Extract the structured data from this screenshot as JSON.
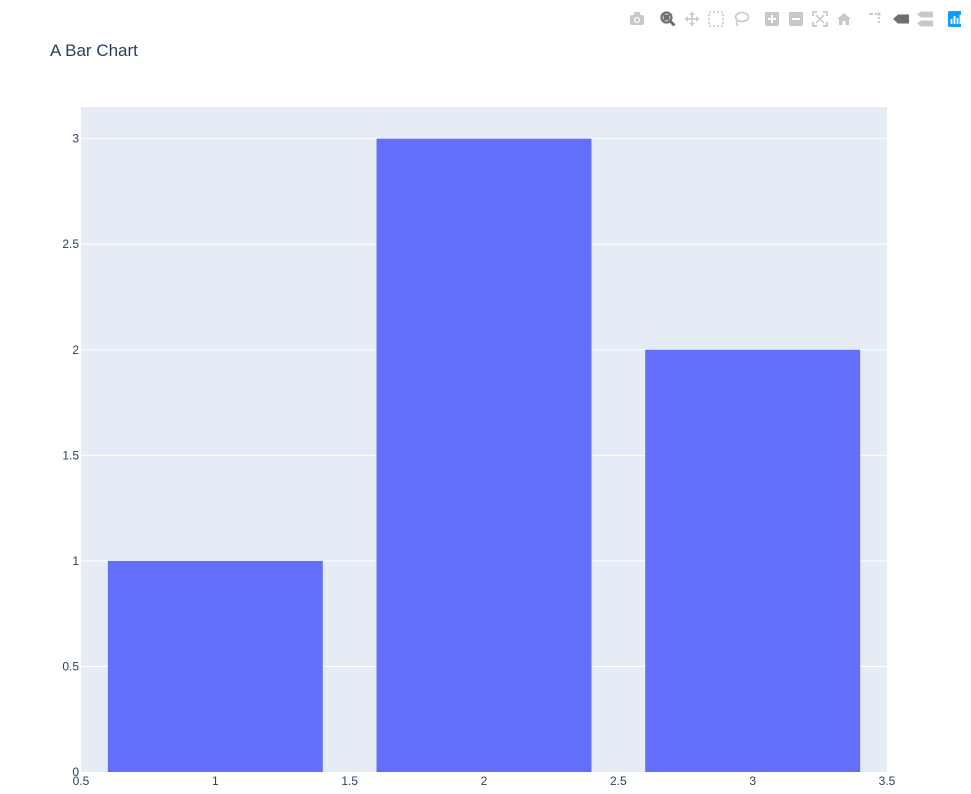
{
  "chart": {
    "title": "A Bar Chart"
  },
  "modebar": {
    "buttons": [
      {
        "name": "download-plot-icon",
        "active": false
      },
      {
        "name": "zoom-icon",
        "active": true
      },
      {
        "name": "pan-icon",
        "active": false
      },
      {
        "name": "box-select-icon",
        "active": false
      },
      {
        "name": "lasso-select-icon",
        "active": false
      },
      {
        "name": "zoom-in-icon",
        "active": false
      },
      {
        "name": "zoom-out-icon",
        "active": false
      },
      {
        "name": "autoscale-icon",
        "active": false
      },
      {
        "name": "reset-axes-icon",
        "active": false
      },
      {
        "name": "toggle-spike-lines-icon",
        "active": false
      },
      {
        "name": "hover-closest-icon",
        "active": true
      },
      {
        "name": "hover-compare-icon",
        "active": false
      },
      {
        "name": "plotly-logo-icon",
        "active": false
      }
    ]
  },
  "colors": {
    "bar": "#636efa",
    "plot_bg": "#e5ecf6",
    "grid": "#ffffff",
    "text": "#2a3f5f",
    "modebar_inactive": "#c8c8c8",
    "modebar_active": "#6e6e6e",
    "plotly_logo": "#119dff"
  },
  "chart_data": {
    "type": "bar",
    "title": "A Bar Chart",
    "x": [
      1,
      2,
      3
    ],
    "values": [
      1,
      3,
      2
    ],
    "xlabel": "",
    "ylabel": "",
    "xlim": [
      0.5,
      3.5
    ],
    "ylim": [
      0,
      3.15
    ],
    "xticks": [
      "0.5",
      "1",
      "1.5",
      "2",
      "2.5",
      "3",
      "3.5"
    ],
    "yticks": [
      "0",
      "0.5",
      "1",
      "1.5",
      "2",
      "2.5",
      "3"
    ],
    "grid": true
  }
}
